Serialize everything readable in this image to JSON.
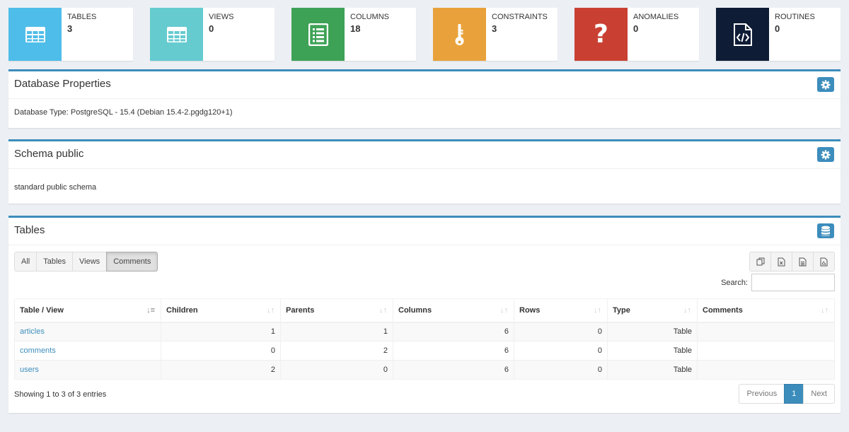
{
  "stats": [
    {
      "label": "TABLES",
      "value": "3",
      "color": "#4fbde9",
      "icon": "table-icon"
    },
    {
      "label": "VIEWS",
      "value": "0",
      "color": "#65cbcf",
      "icon": "table-icon"
    },
    {
      "label": "COLUMNS",
      "value": "18",
      "color": "#3ea256",
      "icon": "list-icon"
    },
    {
      "label": "CONSTRAINTS",
      "value": "3",
      "color": "#e9a23b",
      "icon": "key-icon"
    },
    {
      "label": "ANOMALIES",
      "value": "0",
      "color": "#c94032",
      "icon": "question-icon"
    },
    {
      "label": "ROUTINES",
      "value": "0",
      "color": "#0e1c35",
      "icon": "code-file-icon"
    }
  ],
  "db_panel": {
    "title": "Database Properties",
    "body": "Database Type: PostgreSQL - 15.4 (Debian 15.4-2.pgdg120+1)"
  },
  "schema_panel": {
    "title": "Schema public",
    "body": "standard public schema"
  },
  "tables_panel": {
    "title": "Tables",
    "filters": [
      "All",
      "Tables",
      "Views",
      "Comments"
    ],
    "active_filter": "Comments",
    "search_label": "Search:",
    "search_value": "",
    "columns": [
      "Table / View",
      "Children",
      "Parents",
      "Columns",
      "Rows",
      "Type",
      "Comments"
    ],
    "rows": [
      {
        "name": "articles",
        "children": "1",
        "parents": "1",
        "columns": "6",
        "rows": "0",
        "type": "Table",
        "comments": ""
      },
      {
        "name": "comments",
        "children": "0",
        "parents": "2",
        "columns": "6",
        "rows": "0",
        "type": "Table",
        "comments": ""
      },
      {
        "name": "users",
        "children": "2",
        "parents": "0",
        "columns": "6",
        "rows": "0",
        "type": "Table",
        "comments": ""
      }
    ],
    "info": "Showing 1 to 3 of 3 entries",
    "pager": {
      "previous": "Previous",
      "current": "1",
      "next": "Next"
    }
  },
  "accent_color": "#3c8dbc"
}
